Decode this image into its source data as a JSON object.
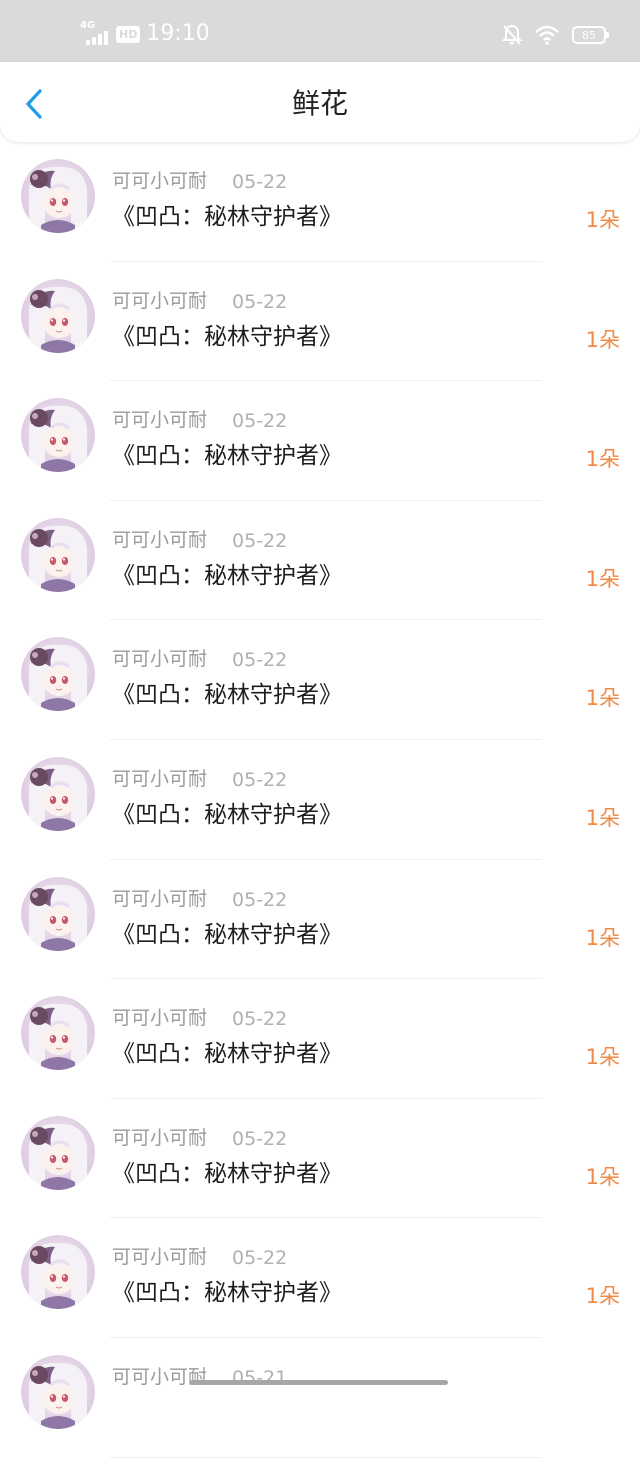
{
  "status_bar": {
    "network": "4G",
    "hd": "HD",
    "time": "19:10",
    "battery": "85",
    "icons": [
      "signal-icon",
      "mute-bell-icon",
      "wifi-icon",
      "battery-icon"
    ]
  },
  "header": {
    "title": "鲜花",
    "back_icon": "chevron-left-icon"
  },
  "colors": {
    "accent_blue": "#1e9be9",
    "flower_count": "#f08a45",
    "status_bar_bg": "#dadada"
  },
  "records": [
    {
      "user": "可可小可耐",
      "date": "05-22",
      "book": "《凹凸：秘林守护者》",
      "count": "1朵"
    },
    {
      "user": "可可小可耐",
      "date": "05-22",
      "book": "《凹凸：秘林守护者》",
      "count": "1朵"
    },
    {
      "user": "可可小可耐",
      "date": "05-22",
      "book": "《凹凸：秘林守护者》",
      "count": "1朵"
    },
    {
      "user": "可可小可耐",
      "date": "05-22",
      "book": "《凹凸：秘林守护者》",
      "count": "1朵"
    },
    {
      "user": "可可小可耐",
      "date": "05-22",
      "book": "《凹凸：秘林守护者》",
      "count": "1朵"
    },
    {
      "user": "可可小可耐",
      "date": "05-22",
      "book": "《凹凸：秘林守护者》",
      "count": "1朵"
    },
    {
      "user": "可可小可耐",
      "date": "05-22",
      "book": "《凹凸：秘林守护者》",
      "count": "1朵"
    },
    {
      "user": "可可小可耐",
      "date": "05-22",
      "book": "《凹凸：秘林守护者》",
      "count": "1朵"
    },
    {
      "user": "可可小可耐",
      "date": "05-22",
      "book": "《凹凸：秘林守护者》",
      "count": "1朵"
    },
    {
      "user": "可可小可耐",
      "date": "05-22",
      "book": "《凹凸：秘林守护者》",
      "count": "1朵"
    },
    {
      "user": "可可小可耐",
      "date": "05-21",
      "book": "",
      "count": ""
    }
  ]
}
